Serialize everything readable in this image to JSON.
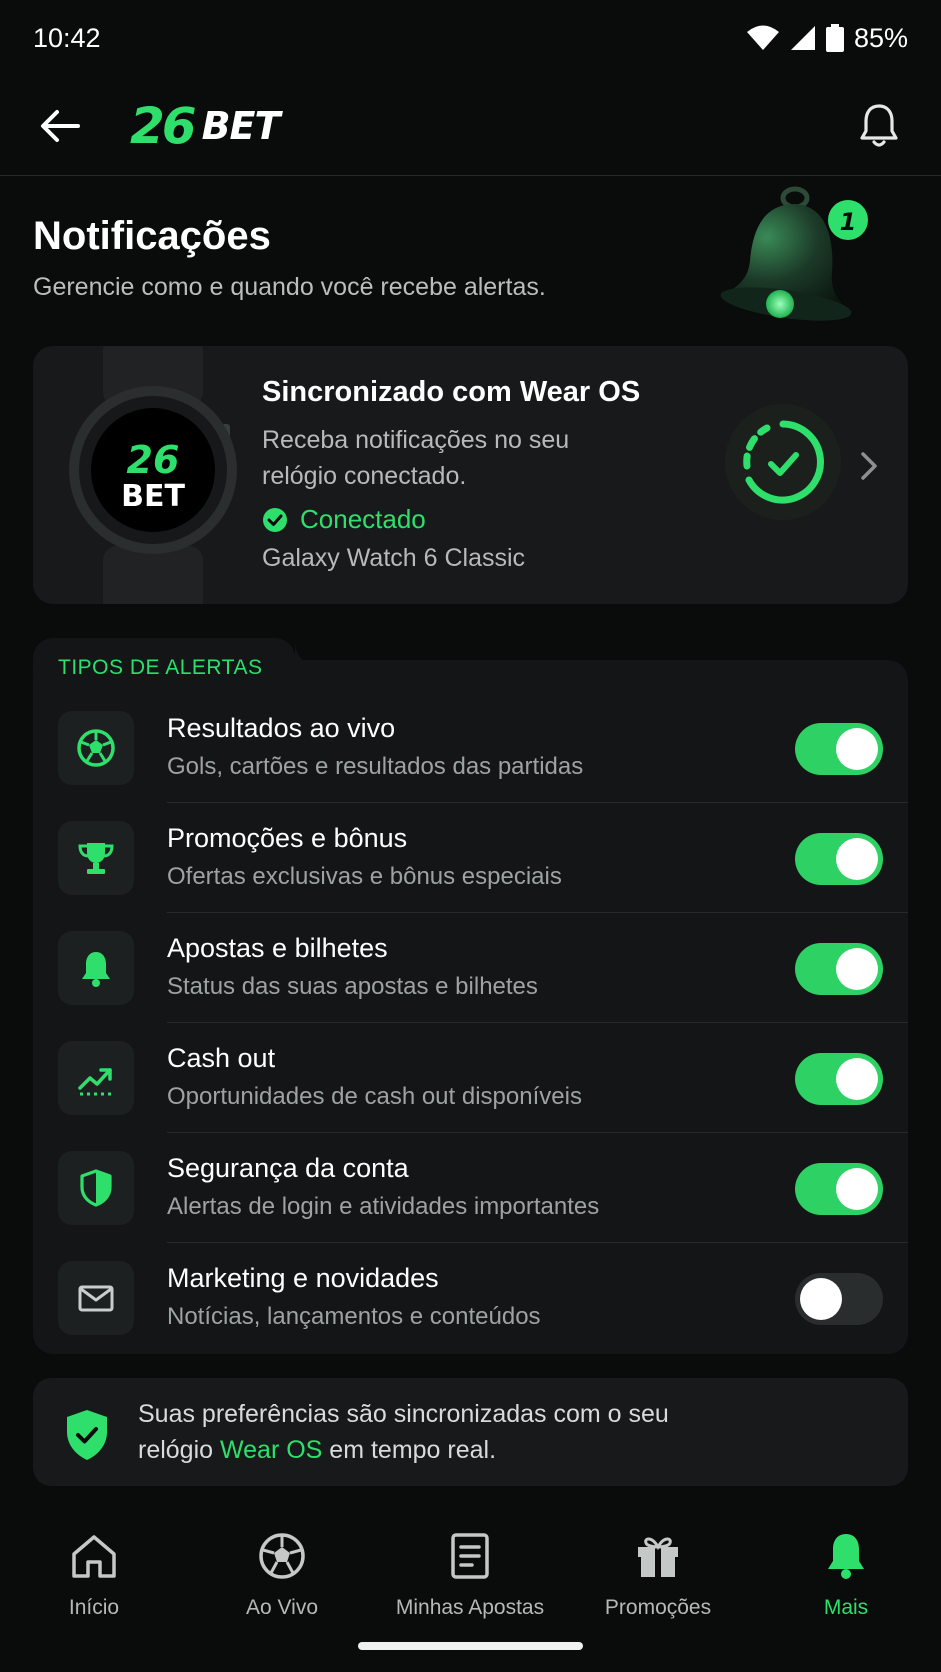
{
  "status_bar": {
    "time": "10:42",
    "battery": "85%"
  },
  "header": {
    "logo_number": "26",
    "logo_text": "BET"
  },
  "page": {
    "title": "Notificações",
    "subtitle": "Gerencie como e quando você recebe alertas.",
    "hero_badge_count": "1"
  },
  "wear_card": {
    "title": "Sincronizado com Wear OS",
    "description": "Receba notificações no seu relógio conectado.",
    "status": "Conectado",
    "device": "Galaxy Watch 6 Classic",
    "watch_face_number": "26",
    "watch_face_text": "BET"
  },
  "alerts": {
    "section_label": "TIPOS DE ALERTAS",
    "items": [
      {
        "title": "Resultados ao vivo",
        "description": "Gols, cartões e resultados das partidas",
        "icon": "soccer-ball-icon",
        "enabled": true
      },
      {
        "title": "Promoções e bônus",
        "description": "Ofertas exclusivas e bônus especiais",
        "icon": "trophy-icon",
        "enabled": true
      },
      {
        "title": "Apostas e bilhetes",
        "description": "Status das suas apostas e bilhetes",
        "icon": "bell-icon",
        "enabled": true
      },
      {
        "title": "Cash out",
        "description": "Oportunidades de cash out disponíveis",
        "icon": "trending-up-icon",
        "enabled": true
      },
      {
        "title": "Segurança da conta",
        "description": "Alertas de login e atividades importantes",
        "icon": "shield-icon",
        "enabled": true
      },
      {
        "title": "Marketing e novidades",
        "description": "Notícias, lançamentos e conteúdos",
        "icon": "mail-icon",
        "enabled": false
      }
    ]
  },
  "sync_banner": {
    "text_before": "Suas preferências são sincronizadas com o seu relógio ",
    "highlight": "Wear OS",
    "text_after": " em tempo real."
  },
  "bottom_nav": {
    "items": [
      {
        "label": "Início",
        "icon": "home-icon",
        "active": false
      },
      {
        "label": "Ao Vivo",
        "icon": "soccer-ball-icon",
        "active": false
      },
      {
        "label": "Minhas Apostas",
        "icon": "ticket-icon",
        "active": false
      },
      {
        "label": "Promoções",
        "icon": "gift-icon",
        "active": false
      },
      {
        "label": "Mais",
        "icon": "bell-icon",
        "active": true
      }
    ]
  },
  "colors": {
    "accent": "#2ee06b",
    "background": "#0a0b0b",
    "card": "#17191a"
  }
}
